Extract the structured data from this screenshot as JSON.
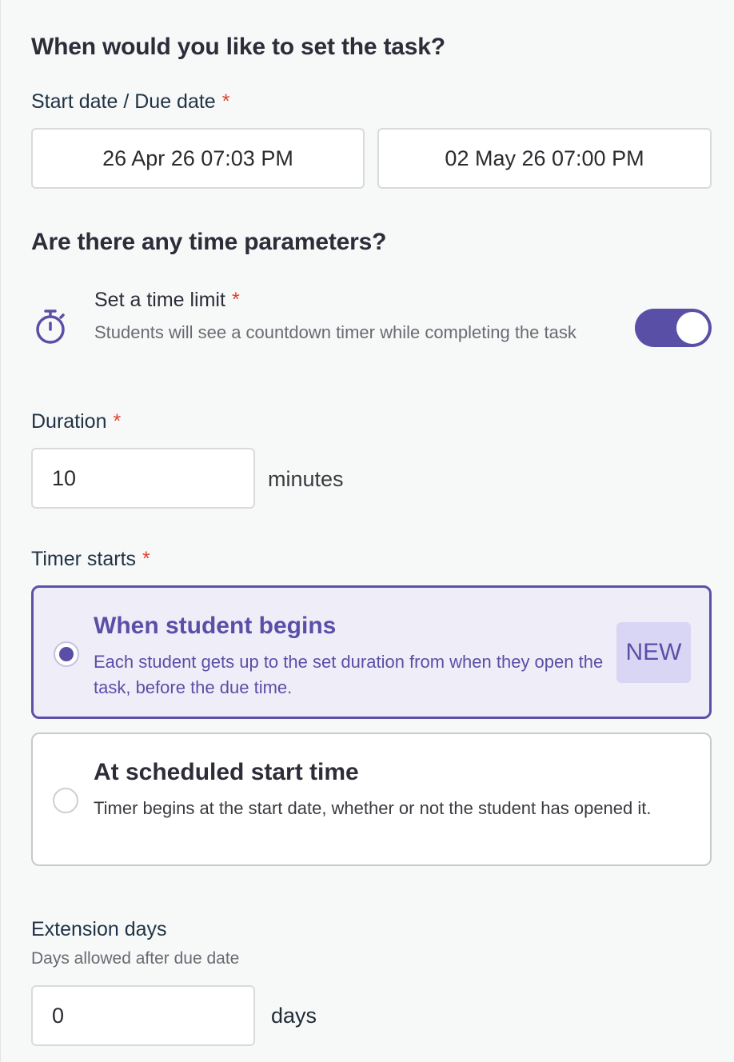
{
  "schedule": {
    "heading": "When would you like to set the task?",
    "label": "Start date / Due date",
    "required_mark": "*",
    "start_date": "26 Apr 26 07:03 PM",
    "due_date": "02 May 26 07:00 PM"
  },
  "time_params": {
    "heading": "Are there any time parameters?",
    "time_limit": {
      "title": "Set a time limit",
      "required_mark": "*",
      "description": "Students will see a countdown timer while completing the task",
      "enabled": true,
      "icon": "stopwatch-icon"
    },
    "duration": {
      "label": "Duration",
      "required_mark": "*",
      "value": "10",
      "unit": "minutes"
    },
    "timer_starts": {
      "label": "Timer starts",
      "required_mark": "*",
      "options": [
        {
          "title": "When student begins",
          "description": "Each student gets up to the set duration from when they open the task, before the due time.",
          "badge": "NEW",
          "selected": true
        },
        {
          "title": "At scheduled start time",
          "description": "Timer begins at the start date, whether or not the student has opened it.",
          "selected": false
        }
      ]
    }
  },
  "extension": {
    "label": "Extension days",
    "hint": "Days allowed after due date",
    "value": "0",
    "unit": "days"
  },
  "colors": {
    "accent": "#5a4fa6",
    "required": "#e0432f",
    "selected_bg": "#efedf8",
    "badge_bg": "#d9d6f5"
  }
}
